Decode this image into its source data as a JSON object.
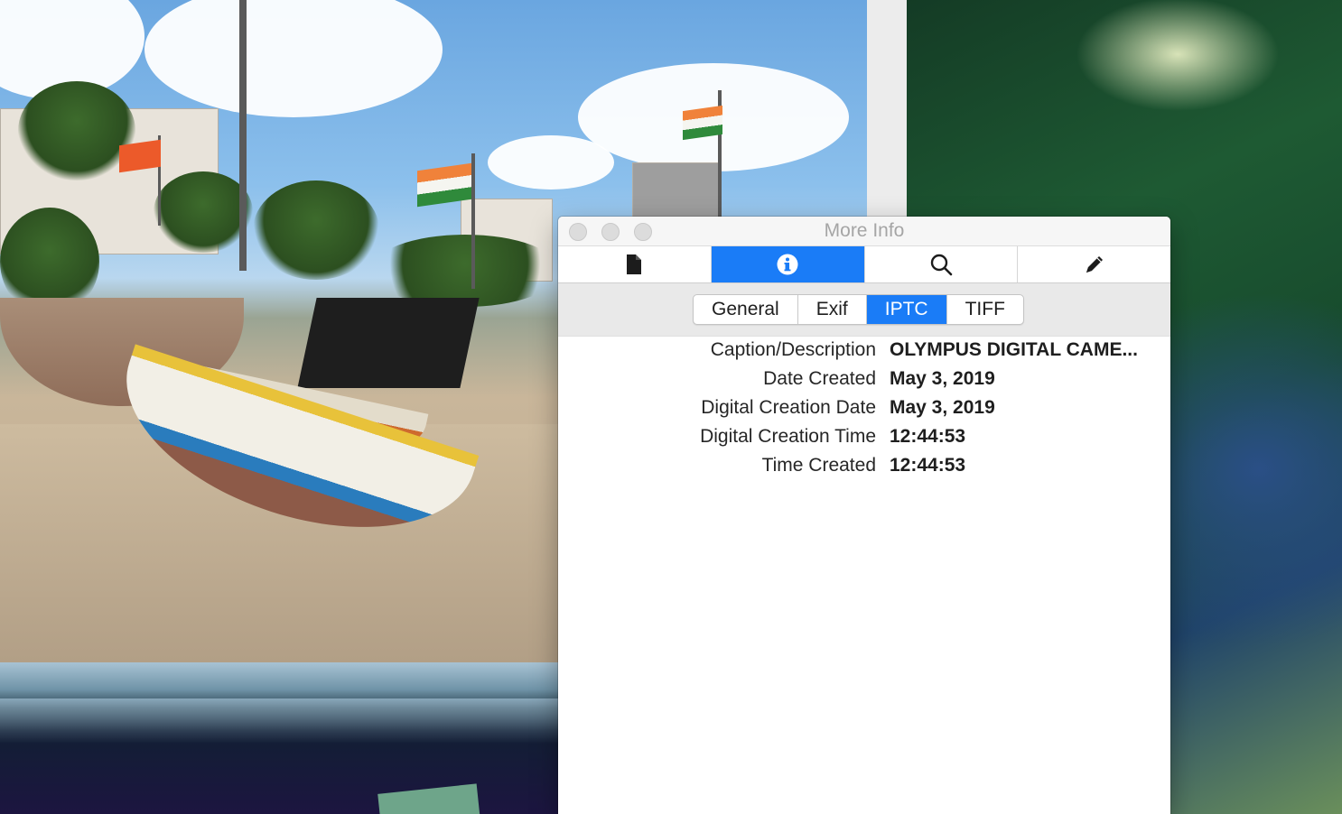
{
  "window": {
    "title": "More Info"
  },
  "toolbar": {
    "tabs": [
      {
        "icon": "document-icon",
        "active": false
      },
      {
        "icon": "info-icon",
        "active": true
      },
      {
        "icon": "magnifier-icon",
        "active": false
      },
      {
        "icon": "pencil-icon",
        "active": false
      }
    ]
  },
  "segments": {
    "items": [
      "General",
      "Exif",
      "IPTC",
      "TIFF"
    ],
    "selected": "IPTC"
  },
  "iptc": {
    "rows": [
      {
        "key": "Caption/Description",
        "value": "OLYMPUS DIGITAL CAME..."
      },
      {
        "key": "Date Created",
        "value": "May 3, 2019"
      },
      {
        "key": "Digital Creation Date",
        "value": "May 3, 2019"
      },
      {
        "key": "Digital Creation Time",
        "value": "12:44:53"
      },
      {
        "key": "Time Created",
        "value": "12:44:53"
      }
    ]
  },
  "colors": {
    "accent": "#1a7cf7",
    "window_bg": "#ffffff",
    "segment_bar_bg": "#e9e9e9"
  }
}
